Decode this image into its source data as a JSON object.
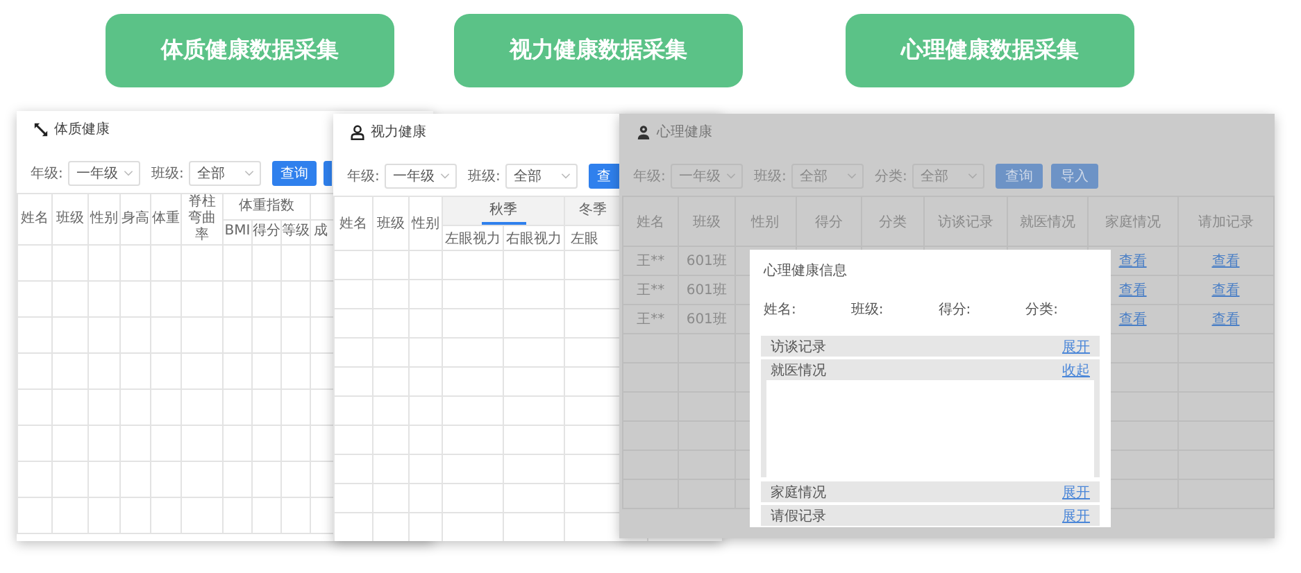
{
  "feature_buttons": [
    "体质健康数据采集",
    "视力健康数据采集",
    "心理健康数据采集"
  ],
  "physical": {
    "title": "体质健康",
    "filters": [
      {
        "label": "年级:",
        "value": "一年级"
      },
      {
        "label": "班级:",
        "value": "全部"
      }
    ],
    "query_button": "查询",
    "columns": [
      {
        "label": "姓名"
      },
      {
        "label": "班级"
      },
      {
        "label": "性别"
      },
      {
        "label": "身高"
      },
      {
        "label": "体重"
      },
      {
        "label": "脊柱弯曲率"
      },
      {
        "label": "体重指数",
        "children": [
          "BMI",
          "得分",
          "等级"
        ]
      },
      {
        "children": [
          "成"
        ]
      }
    ]
  },
  "vision": {
    "title": "视力健康",
    "filters": [
      {
        "label": "年级:",
        "value": "一年级"
      },
      {
        "label": "班级:",
        "value": "全部"
      }
    ],
    "query_button": "查",
    "columns": [
      "姓名",
      "班级",
      "性别"
    ],
    "seasons": [
      {
        "label": "秋季",
        "selected": true,
        "children": [
          "左眼视力",
          "右眼视力"
        ]
      },
      {
        "label": "冬季",
        "selected": false,
        "children": [
          "左眼"
        ]
      }
    ]
  },
  "mental": {
    "title": "心理健康",
    "filters": [
      {
        "label": "年级:",
        "value": "一年级"
      },
      {
        "label": "班级:",
        "value": "全部"
      },
      {
        "label": "分类:",
        "value": "全部"
      }
    ],
    "buttons": [
      "查询",
      "导入"
    ],
    "columns": [
      "姓名",
      "班级",
      "性别",
      "得分",
      "分类",
      "访谈记录",
      "就医情况",
      "家庭情况",
      "请加记录"
    ],
    "rows": [
      {
        "name": "王**",
        "class": "601班",
        "family": "查看",
        "leave": "查看"
      },
      {
        "name": "王**",
        "class": "601班",
        "family": "查看",
        "leave": "查看"
      },
      {
        "name": "王**",
        "class": "601班",
        "family": "查看",
        "leave": "查看"
      }
    ],
    "dialog": {
      "title": "心理健康信息",
      "fields": [
        "姓名:",
        "班级:",
        "得分:",
        "分类:"
      ],
      "sections": [
        {
          "label": "访谈记录",
          "action": "展开",
          "expanded": false
        },
        {
          "label": "就医情况",
          "action": "收起",
          "expanded": true
        },
        {
          "label": "家庭情况",
          "action": "展开",
          "expanded": false
        },
        {
          "label": "请假记录",
          "action": "展开",
          "expanded": false
        }
      ]
    }
  }
}
